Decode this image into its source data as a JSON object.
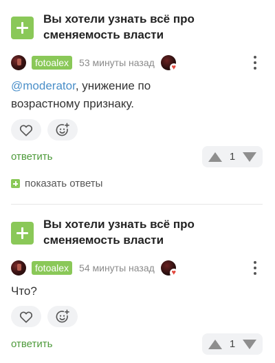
{
  "comments": [
    {
      "post_title": "Вы хотели узнать всё про сменяемость власти",
      "author": "fotoalex",
      "time": "53 минуты назад",
      "mention": "@moderator",
      "text": ", унижение по возрастному признаку.",
      "reply_label": "ответить",
      "vote_count": "1",
      "show_replies": "показать ответы"
    },
    {
      "post_title": "Вы хотели узнать всё про сменяемость власти",
      "author": "fotoalex",
      "time": "54 минуты назад",
      "text": "Что?",
      "reply_label": "ответить",
      "vote_count": "1"
    }
  ],
  "colors": {
    "accent_green": "#8ac858",
    "link_blue": "#4a8fc9",
    "reply_green": "#4d9a3a"
  }
}
